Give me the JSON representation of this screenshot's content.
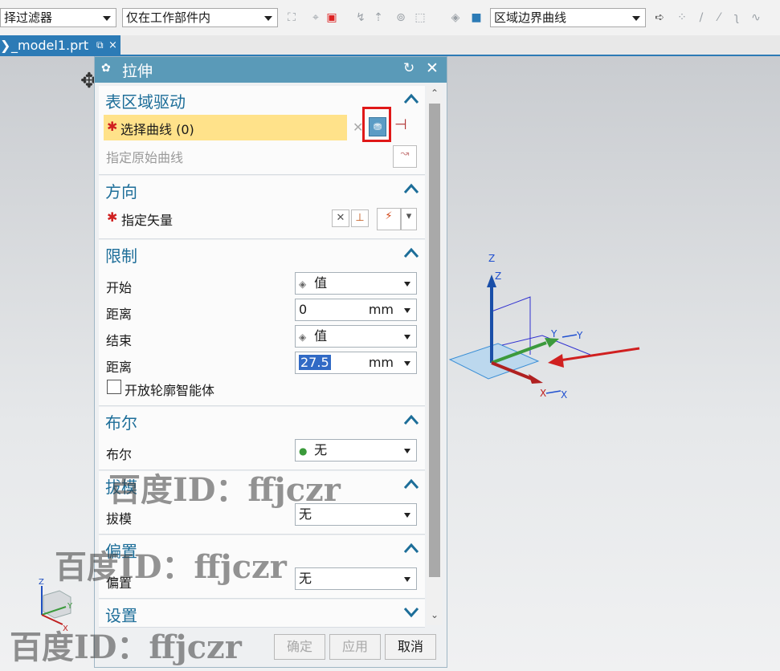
{
  "toolbar": {
    "filter_value": "择过滤器",
    "scope_value": "仅在工作部件内",
    "curve_rule_value": "区域边界曲线"
  },
  "tab": {
    "label": "_model1.prt"
  },
  "dialog": {
    "title": "拉伸",
    "sections": {
      "surface_region": {
        "header": "表区域驱动",
        "select_curve": "选择曲线 (0)",
        "original_curve": "指定原始曲线"
      },
      "direction": {
        "header": "方向",
        "vector": "指定矢量"
      },
      "limits": {
        "header": "限制",
        "start_label": "开始",
        "start_value": "值",
        "start_dist_label": "距离",
        "start_dist_value": "0",
        "end_label": "结束",
        "end_value": "值",
        "end_dist_label": "距离",
        "end_dist_value": "27.5",
        "unit": "mm",
        "open_profile": "开放轮廓智能体"
      },
      "boolean": {
        "header": "布尔",
        "label": "布尔",
        "value": "无"
      },
      "draft": {
        "header": "拔模",
        "label": "拔模",
        "value": "无"
      },
      "offset": {
        "header": "偏置",
        "label": "偏置",
        "value": "无"
      },
      "settings": {
        "header": "设置"
      }
    },
    "buttons": {
      "ok": "确定",
      "apply": "应用",
      "cancel": "取消"
    }
  },
  "axes": {
    "z": "Z",
    "y": "Y",
    "x": "X"
  },
  "watermarks": [
    "百度ID：ffjczr",
    "百度ID：ffjczr",
    "百度ID：ffjczr"
  ],
  "colors": {
    "accent": "#5a9ab8",
    "highlight": "#ffe28a",
    "header_text": "#1d6e99"
  }
}
